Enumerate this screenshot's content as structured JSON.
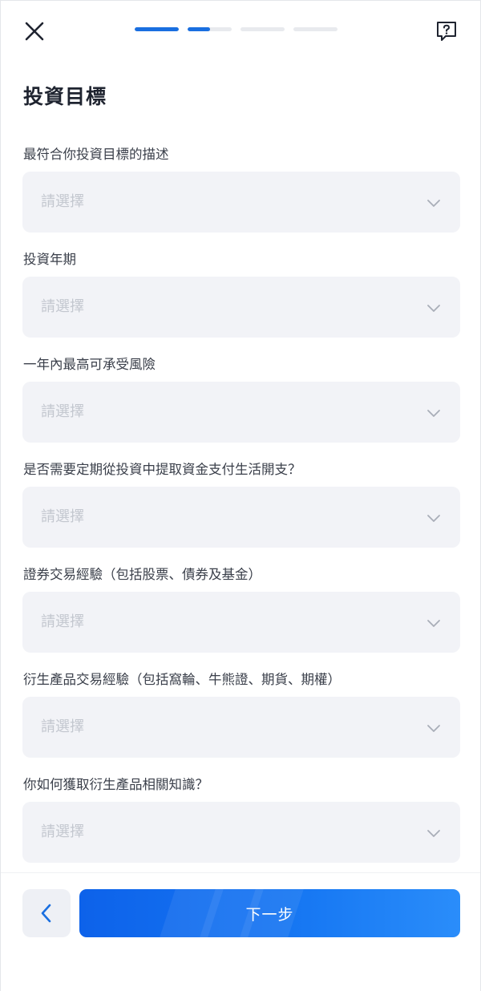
{
  "header": {
    "close_icon": "close-icon",
    "help_icon": "question-message-icon",
    "progress": [
      1,
      0.5,
      0,
      0
    ],
    "accent_color": "#1a6fe0"
  },
  "page_title": "投資目標",
  "fields": [
    {
      "label": "最符合你投資目標的描述",
      "placeholder": "請選擇"
    },
    {
      "label": "投資年期",
      "placeholder": "請選擇"
    },
    {
      "label": "一年內最高可承受風險",
      "placeholder": "請選擇"
    },
    {
      "label": "是否需要定期從投資中提取資金支付生活開支？",
      "placeholder": "請選擇"
    },
    {
      "label": "證券交易經驗（包括股票、債券及基金）",
      "placeholder": "請選擇"
    },
    {
      "label": "衍生產品交易經驗（包括窩輪、牛熊證、期貨、期權）",
      "placeholder": "請選擇"
    },
    {
      "label": "你如何獲取衍生產品相關知識？",
      "placeholder": "請選擇"
    }
  ],
  "footer": {
    "back_icon": "chevron-left-icon",
    "next_label": "下一步"
  }
}
